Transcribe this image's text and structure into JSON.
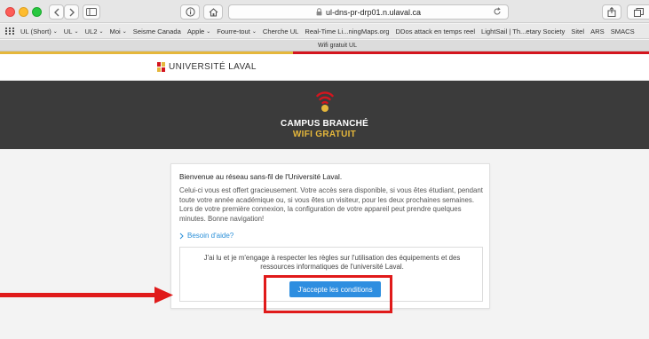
{
  "browser": {
    "url": "ul-dns-pr-drp01.n.ulaval.ca",
    "tab_title": "Wifi gratuit UL"
  },
  "bookmarks": [
    {
      "label": "UL (Short)",
      "menu": true
    },
    {
      "label": "UL",
      "menu": true
    },
    {
      "label": "UL2",
      "menu": true
    },
    {
      "label": "Moi",
      "menu": true
    },
    {
      "label": "Seisme Canada",
      "menu": false
    },
    {
      "label": "Apple",
      "menu": true
    },
    {
      "label": "Fourre-tout",
      "menu": true
    },
    {
      "label": "Cherche UL",
      "menu": false
    },
    {
      "label": "Real-Time Li...ningMaps.org",
      "menu": false
    },
    {
      "label": "DDos attack en temps reel",
      "menu": false
    },
    {
      "label": "LightSail | Th...etary Society",
      "menu": false
    },
    {
      "label": "Sitel",
      "menu": false
    },
    {
      "label": "ARS",
      "menu": false
    },
    {
      "label": "SMACS",
      "menu": false
    }
  ],
  "header": {
    "logo_text": "UNIVERSITÉ LAVAL",
    "colors": {
      "gold": "#e5b73b",
      "red": "#d4151e"
    }
  },
  "banner": {
    "title": "CAMPUS BRANCHÉ",
    "subtitle": "WIFI GRATUIT",
    "wifi_icon": "wifi-icon"
  },
  "card": {
    "heading": "Bienvenue au réseau sans-fil de l'Université Laval.",
    "body": "Celui-ci vous est offert gracieusement. Votre accès sera disponible, si vous êtes étudiant, pendant toute votre année académique ou, si vous êtes un visiteur, pour les deux prochaines semaines. Lors de votre première connexion, la configuration de votre appareil peut prendre quelques minutes. Bonne navigation!",
    "help_link": "Besoin d'aide?",
    "agreement_text": "J'ai lu et je m'engage à respecter les règles sur l'utilisation des équipements et des ressources informatiques de l'université Laval.",
    "accept_button": "J'accepte les conditions"
  }
}
